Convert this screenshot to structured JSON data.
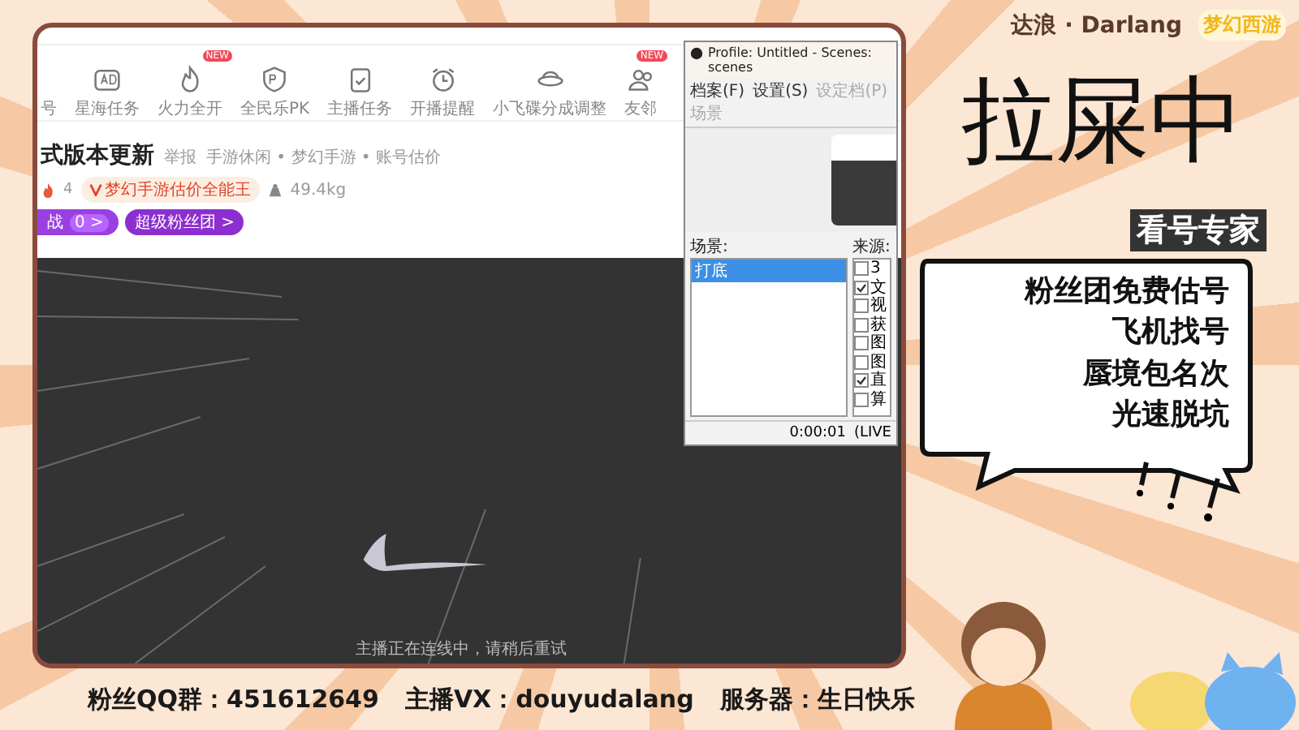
{
  "browser": {
    "nav_items": [
      {
        "label": "号"
      },
      {
        "label": "星海任务"
      },
      {
        "label": "火力全开",
        "badge": "NEW"
      },
      {
        "label": "全民乐PK"
      },
      {
        "label": "主播任务"
      },
      {
        "label": "开播提醒"
      },
      {
        "label": "小飞碟分成调整"
      },
      {
        "label": "友邻",
        "badge": "NEW"
      }
    ],
    "room": {
      "title": "式版本更新",
      "report": "举报",
      "tags": "手游休闲 • 梦幻手游 • 账号估价",
      "heat": "4",
      "badge": "梦幻手游估价全能王",
      "weight": "49.4kg",
      "challenge": "战",
      "challenge_count": "0 >",
      "fan_club": "超级粉丝团 >"
    },
    "video": {
      "kind": "picture",
      "caption": "主播正在连线中，请稍后重试"
    }
  },
  "obs_window": {
    "title": "Profile: Untitled - Scenes: scenes",
    "menu": [
      {
        "label": "档案(F)",
        "disabled": false
      },
      {
        "label": "设置(S)",
        "disabled": false
      },
      {
        "label": "设定档(P)",
        "disabled": true
      },
      {
        "label": "场景",
        "disabled": true
      }
    ],
    "scenes_label": "场景:",
    "scenes": [
      {
        "label": "打底",
        "selected": true
      }
    ],
    "sources_label": "来源:",
    "sources": [
      {
        "label": "3",
        "checked": false
      },
      {
        "label": "文",
        "checked": true
      },
      {
        "label": "视",
        "checked": false
      },
      {
        "label": "获",
        "checked": false
      },
      {
        "label": "图",
        "checked": false
      },
      {
        "label": "图",
        "checked": false
      },
      {
        "label": "直",
        "checked": true
      },
      {
        "label": "算",
        "checked": false
      }
    ],
    "time": "0:00:01",
    "live": "(LIVE"
  },
  "overlay": {
    "streamer": "达浪 · Darlang",
    "logo": "梦幻西游",
    "status": "拉屎中",
    "tag": "看号专家",
    "bubble_lines": [
      "粉丝团免费估号",
      "飞机找号",
      "蜃境包名次",
      "光速脱坑"
    ]
  },
  "footer": [
    "粉丝QQ群：451612649",
    "主播VX：douyudalang",
    "服务器：生日快乐"
  ]
}
